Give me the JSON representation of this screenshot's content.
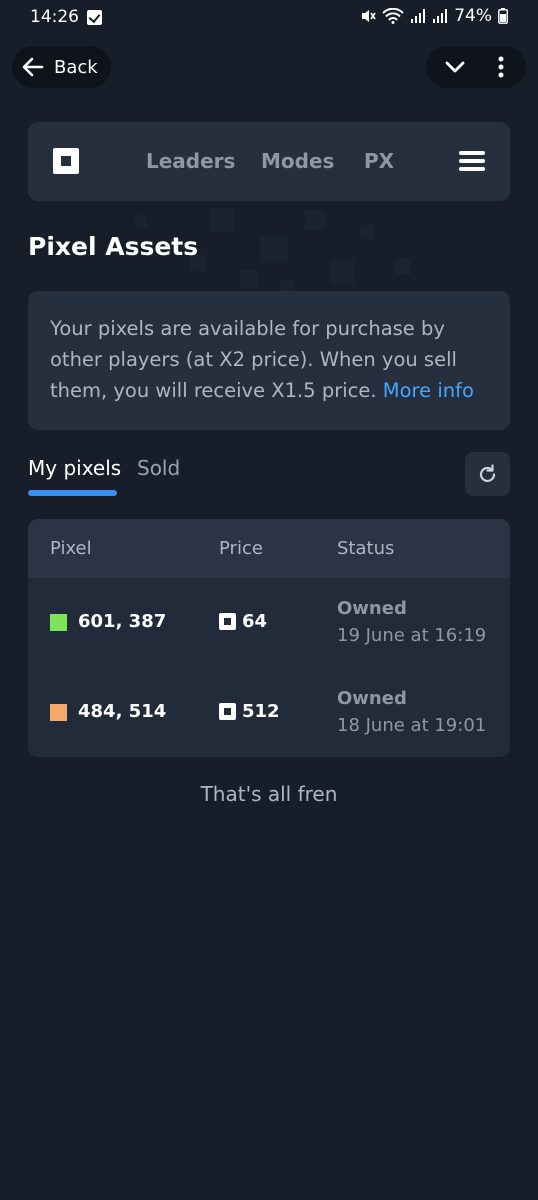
{
  "status_bar": {
    "time": "14:26",
    "battery": "74%"
  },
  "topbar": {
    "back_label": "Back"
  },
  "nav": {
    "links": [
      "Leaders",
      "Modes",
      "PX"
    ]
  },
  "page": {
    "title": "Pixel Assets"
  },
  "info": {
    "text": "Your pixels are available for purchase by other players (at X2 price). When you sell them, you will receive X1.5 price. ",
    "link": "More info"
  },
  "tabs": [
    {
      "label": "My pixels",
      "active": true
    },
    {
      "label": "Sold",
      "active": false
    }
  ],
  "table": {
    "headers": [
      "Pixel",
      "Price",
      "Status"
    ],
    "rows": [
      {
        "color": "#7ee35a",
        "coords": "601, 387",
        "price": "64",
        "status": "Owned",
        "date": "19 June at 16:19"
      },
      {
        "color": "#f4a96a",
        "coords": "484, 514",
        "price": "512",
        "status": "Owned",
        "date": "18 June at 19:01"
      }
    ]
  },
  "footer": {
    "note": "That's all fren"
  },
  "colors": {
    "background": "#171e29",
    "card": "#252f3e",
    "accent": "#3a8ef0",
    "link": "#46a6ff"
  }
}
